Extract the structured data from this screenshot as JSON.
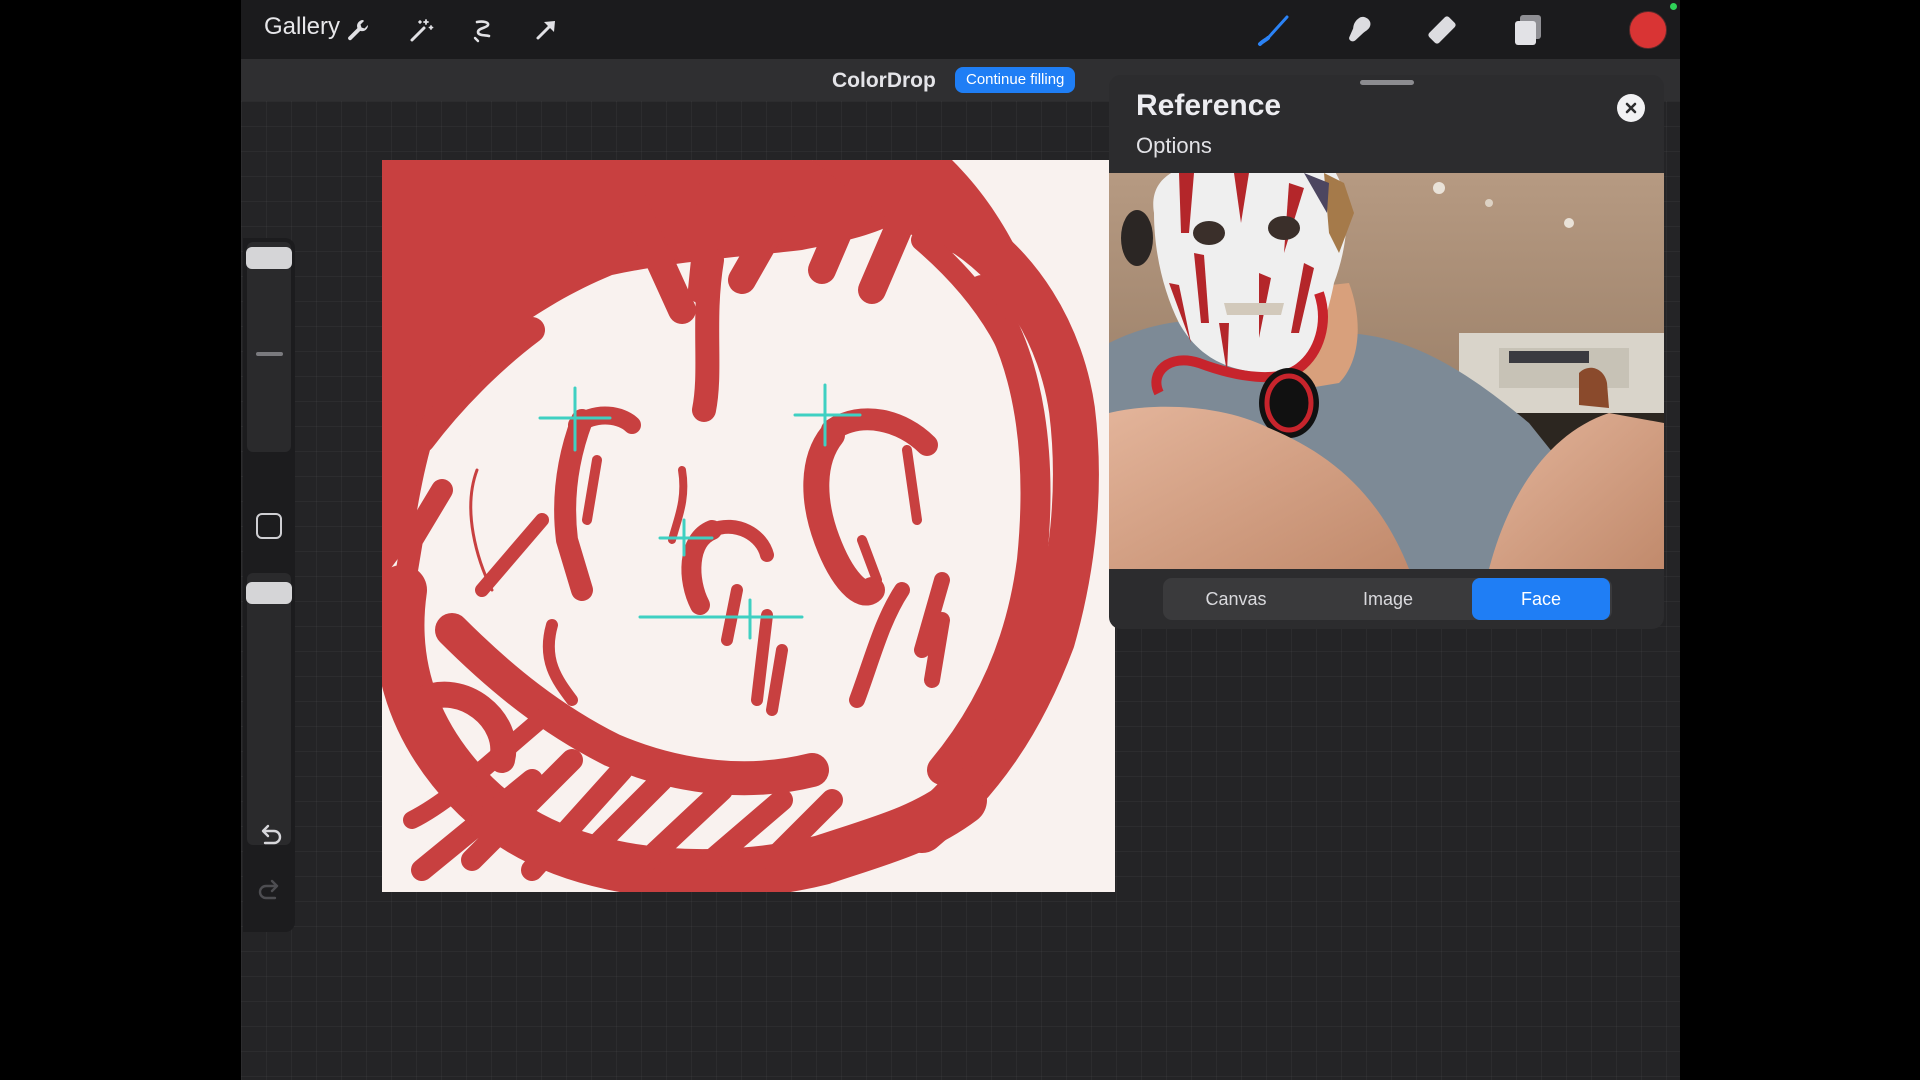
{
  "toolbar": {
    "gallery_label": "Gallery",
    "left_tools": [
      "wrench-icon",
      "magic-wand-icon",
      "selection-icon",
      "transform-arrow-icon"
    ],
    "right_tools": [
      "brush-icon",
      "smudge-icon",
      "eraser-icon",
      "layers-icon"
    ],
    "current_color": "#d93434",
    "accent_color": "#1f7ef5"
  },
  "colordrop": {
    "title": "ColorDrop",
    "continue_label": "Continue filling"
  },
  "sidebar": {
    "icons": [
      "undo-icon",
      "redo-icon"
    ]
  },
  "reference": {
    "title": "Reference",
    "options_label": "Options",
    "tabs": [
      {
        "label": "Canvas",
        "active": false
      },
      {
        "label": "Image",
        "active": false
      },
      {
        "label": "Face",
        "active": true
      }
    ]
  }
}
